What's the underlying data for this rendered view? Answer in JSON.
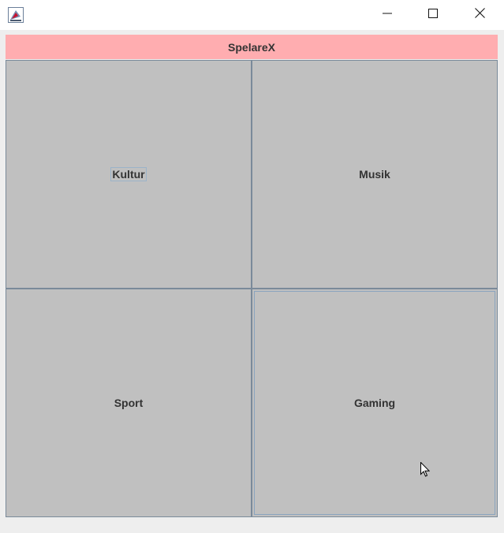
{
  "window": {
    "title": "",
    "controls": {
      "minimize": "minimize-icon",
      "maximize": "maximize-icon",
      "close": "close-icon"
    }
  },
  "header": {
    "title": "SpelareX",
    "color": "#ffadb0"
  },
  "tiles": [
    {
      "label": "Kultur",
      "focused": true
    },
    {
      "label": "Musik",
      "focused": false
    },
    {
      "label": "Sport",
      "focused": false
    },
    {
      "label": "Gaming",
      "focused": false,
      "hovered": true
    }
  ],
  "colors": {
    "tile_bg": "#c0c0c0",
    "tile_border": "#7a8a9a"
  }
}
